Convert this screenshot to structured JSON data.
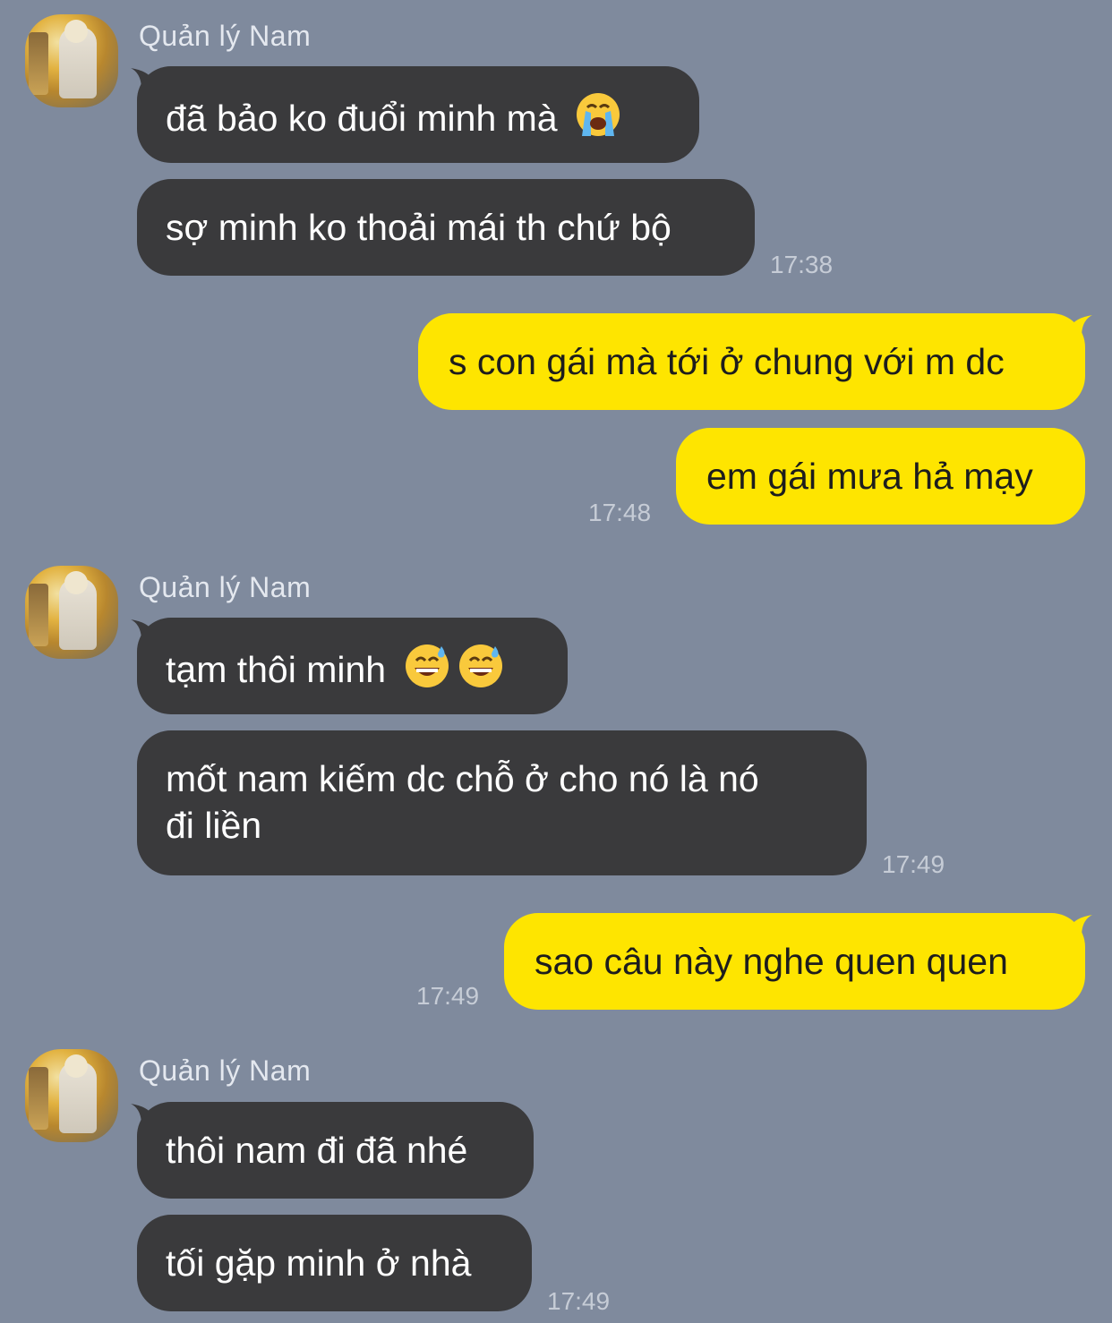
{
  "sender": {
    "name": "Quản lý Nam",
    "avatar_icon": "profile-photo"
  },
  "colors": {
    "background": "#7f8a9d",
    "incoming_bubble": "#3a3a3c",
    "outgoing_bubble": "#fee500"
  },
  "groups": [
    {
      "messages": [
        {
          "text": "đã bảo ko đuổi minh mà",
          "emoji": [
            "loudly-crying-face"
          ]
        },
        {
          "text": "sợ minh ko thoải mái th chứ bộ"
        }
      ],
      "time": "17:38"
    },
    {
      "messages": [
        {
          "text": "s con gái mà tới ở chung với m dc"
        },
        {
          "text": "em gái mưa hả mạy"
        }
      ],
      "time": "17:48"
    },
    {
      "messages": [
        {
          "text": "tạm thôi minh",
          "emoji": [
            "grinning-face-with-sweat",
            "grinning-face-with-sweat"
          ]
        },
        {
          "text_line1": "mốt nam kiếm dc chỗ ở cho nó là nó",
          "text_line2": "đi liền"
        }
      ],
      "time": "17:49"
    },
    {
      "messages": [
        {
          "text": "sao câu này nghe quen quen"
        }
      ],
      "time": "17:49"
    },
    {
      "messages": [
        {
          "text": "thôi nam đi đã nhé"
        },
        {
          "text": "tối gặp minh ở nhà"
        }
      ],
      "time": "17:49"
    }
  ]
}
